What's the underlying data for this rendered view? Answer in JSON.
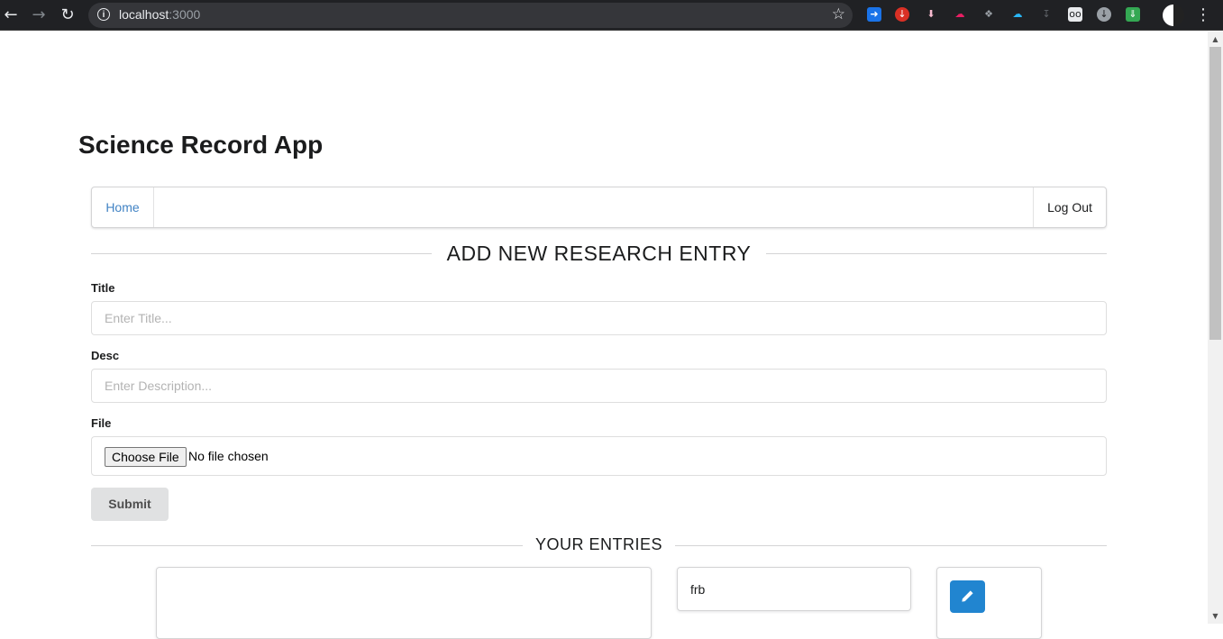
{
  "browser": {
    "url_host": "localhost",
    "url_port": ":3000",
    "extensions": [
      "docs-extension-icon",
      "pocket-icon",
      "download-arrow-icon",
      "cloud-upload-icon",
      "dropbox-icon",
      "cloud-icon",
      "download-icon",
      "screencast-icon",
      "download-circle-icon",
      "chevron-green-icon"
    ]
  },
  "app": {
    "title": "Science Record App"
  },
  "menu": {
    "home": "Home",
    "logout": "Log Out"
  },
  "form": {
    "heading": "ADD NEW RESEARCH ENTRY",
    "title_label": "Title",
    "title_placeholder": "Enter Title...",
    "title_value": "",
    "desc_label": "Desc",
    "desc_placeholder": "Enter Description...",
    "desc_value": "",
    "file_label": "File",
    "file_button": "Choose File",
    "file_status": "No file chosen",
    "submit": "Submit"
  },
  "entries": {
    "heading": "YOUR ENTRIES",
    "items": [
      {
        "title": "frb"
      }
    ]
  },
  "colors": {
    "link": "#4183c4",
    "primary": "#2185d0",
    "button_grey": "#e0e1e2"
  }
}
